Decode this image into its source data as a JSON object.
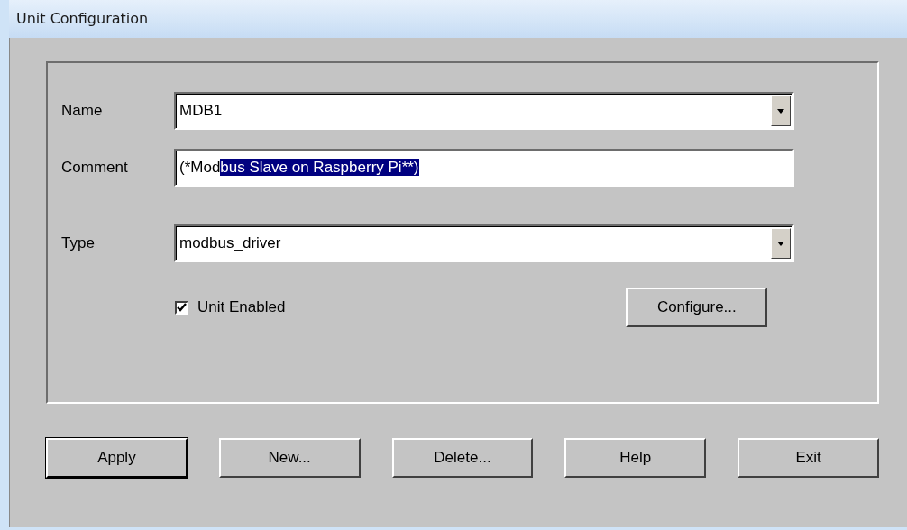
{
  "window": {
    "title": "Unit Configuration"
  },
  "fields": [
    {
      "kind": "combo",
      "label": "Name",
      "value": "MDB1"
    },
    {
      "kind": "text",
      "label": "Comment",
      "value": "(*Mod",
      "selection": "bus Slave on Raspberry Pi**)"
    },
    {
      "kind": "combo",
      "label": "Type",
      "value": "modbus_driver"
    }
  ],
  "unit_enabled": {
    "label": "Unit Enabled",
    "checked": true
  },
  "configure_button": "Configure...",
  "buttons": [
    {
      "label": "Apply",
      "default": true
    },
    {
      "label": "New...",
      "default": false
    },
    {
      "label": "Delete...",
      "default": false
    },
    {
      "label": "Help",
      "default": false
    },
    {
      "label": "Exit",
      "default": false
    }
  ]
}
